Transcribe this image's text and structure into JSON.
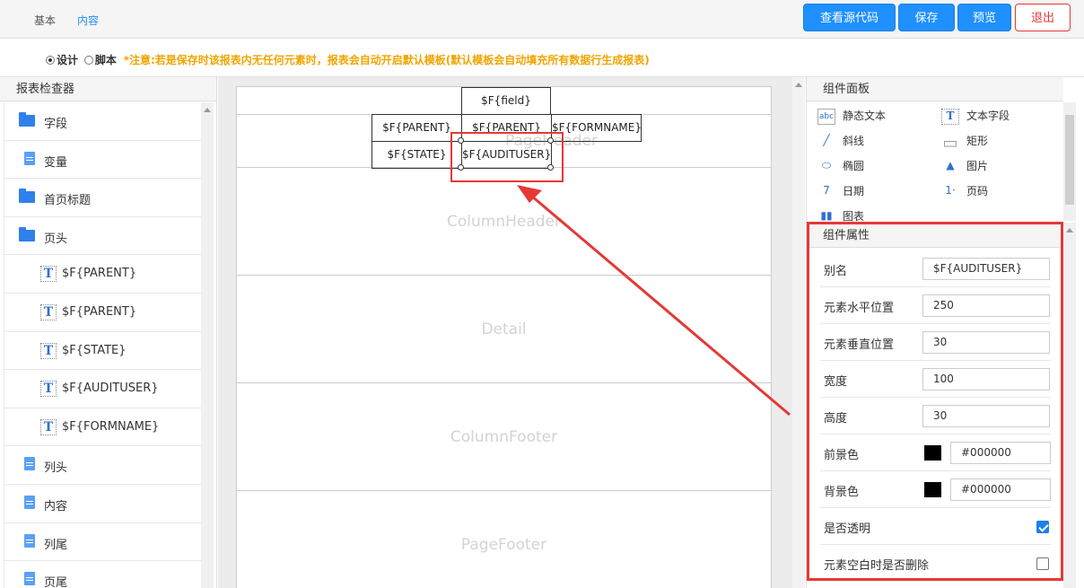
{
  "top": {
    "tabs": [
      "基本",
      "内容"
    ],
    "buttons": {
      "source": "查看源代码",
      "save": "保存",
      "preview": "预览",
      "exit": "退出"
    }
  },
  "mode": {
    "design": "设计",
    "script": "脚本",
    "notice": "*注意:若是保存时该报表内无任何元素时，报表会自动开启默认模板(默认模板会自动填充所有数据行生成报表)"
  },
  "inspector": {
    "title": "报表检查器",
    "items": [
      {
        "label": "字段",
        "icon": "folder-icon"
      },
      {
        "label": "变量",
        "icon": "document-icon"
      },
      {
        "label": "首页标题",
        "icon": "folder-icon"
      },
      {
        "label": "页头",
        "icon": "folder-open-icon"
      },
      {
        "label": "$F{PARENT}",
        "icon": "text-field-icon"
      },
      {
        "label": "$F{PARENT}",
        "icon": "text-field-icon"
      },
      {
        "label": "$F{STATE}",
        "icon": "text-field-icon"
      },
      {
        "label": "$F{AUDITUSER}",
        "icon": "text-field-icon"
      },
      {
        "label": "$F{FORMNAME}",
        "icon": "text-field-icon"
      },
      {
        "label": "列头",
        "icon": "document-icon"
      },
      {
        "label": "内容",
        "icon": "document-icon"
      },
      {
        "label": "列尾",
        "icon": "document-icon"
      },
      {
        "label": "页尾",
        "icon": "document-icon"
      }
    ]
  },
  "canvas": {
    "bands": [
      "PageHeader",
      "ColumnHeader",
      "Detail",
      "ColumnFooter",
      "PageFooter"
    ],
    "cells": {
      "field": "$F{field}",
      "parent1": "$F{PARENT}",
      "parent2": "$F{PARENT}",
      "formname": "$F{FORMNAME}",
      "state": "$F{STATE}",
      "audituser": "$F{AUDITUSER}"
    }
  },
  "components": {
    "title": "组件面板",
    "items": [
      {
        "label": "静态文本",
        "icon": "static-text-icon"
      },
      {
        "label": "文本字段",
        "icon": "text-field-icon"
      },
      {
        "label": "斜线",
        "icon": "line-icon"
      },
      {
        "label": "矩形",
        "icon": "rectangle-icon"
      },
      {
        "label": "椭圆",
        "icon": "ellipse-icon"
      },
      {
        "label": "图片",
        "icon": "image-icon"
      },
      {
        "label": "日期",
        "icon": "calendar-icon"
      },
      {
        "label": "页码",
        "icon": "page-number-icon"
      },
      {
        "label": "图表",
        "icon": "chart-icon"
      }
    ]
  },
  "properties": {
    "title": "组件属性",
    "alias_label": "别名",
    "alias": "$F{AUDITUSER}",
    "x_label": "元素水平位置",
    "x": "250",
    "y_label": "元素垂直位置",
    "y": "30",
    "width_label": "宽度",
    "width": "100",
    "height_label": "高度",
    "height": "30",
    "fg_label": "前景色",
    "fg": "#000000",
    "bg_label": "背景色",
    "bg": "#000000",
    "transparent_label": "是否透明",
    "transparent": true,
    "remove_blank_label": "元素空白时是否删除",
    "remove_blank": false
  }
}
